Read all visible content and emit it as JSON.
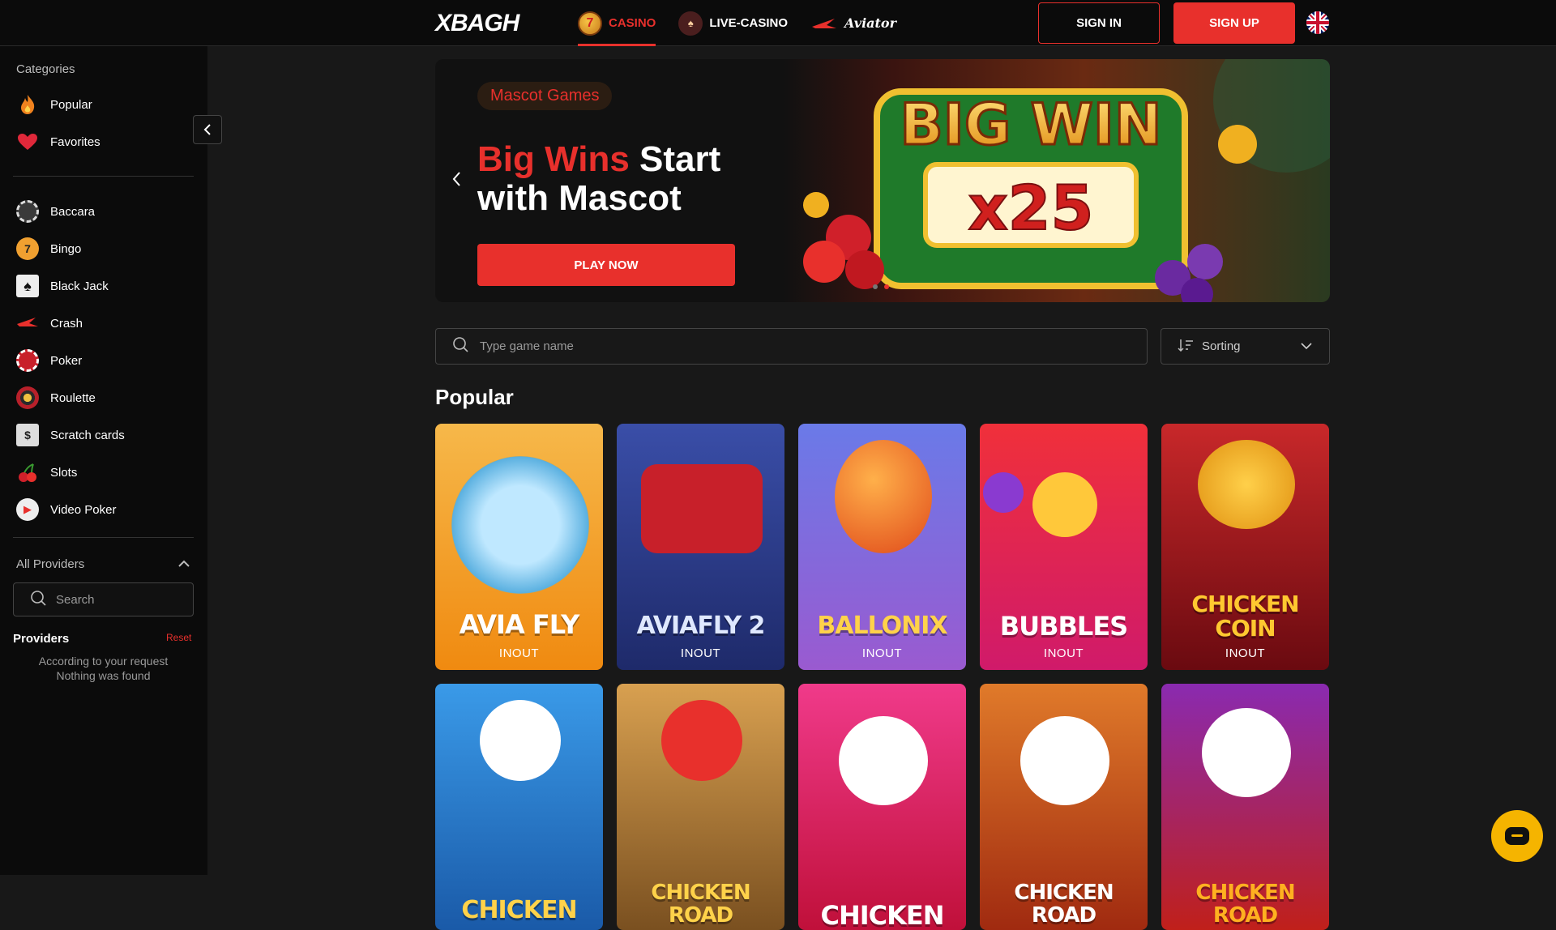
{
  "header": {
    "logo": "XBAGH",
    "nav": [
      {
        "label": "CASINO",
        "icon": "casino-seven-icon",
        "active": true
      },
      {
        "label": "LIVE-CASINO",
        "icon": "live-dealer-icon",
        "active": false
      },
      {
        "label": "Aviator",
        "icon": "aviator-plane-icon",
        "active": false
      }
    ],
    "signin_label": "SIGN IN",
    "signup_label": "SIGN UP",
    "language_icon": "uk-flag-icon",
    "accent_color": "#e8302c"
  },
  "sidebar": {
    "categories_heading": "Categories",
    "top_items": [
      {
        "label": "Popular",
        "icon": "flame-icon"
      },
      {
        "label": "Favorites",
        "icon": "heart-icon"
      }
    ],
    "items": [
      {
        "label": "Baccara",
        "icon": "baccara-chip-icon"
      },
      {
        "label": "Bingo",
        "icon": "bingo-ball-icon"
      },
      {
        "label": "Black Jack",
        "icon": "cards-icon"
      },
      {
        "label": "Crash",
        "icon": "crash-plane-icon"
      },
      {
        "label": "Poker",
        "icon": "poker-chip-icon"
      },
      {
        "label": "Roulette",
        "icon": "roulette-icon"
      },
      {
        "label": "Scratch cards",
        "icon": "scratch-card-icon"
      },
      {
        "label": "Slots",
        "icon": "cherries-icon"
      },
      {
        "label": "Video Poker",
        "icon": "video-poker-icon"
      }
    ],
    "providers_toggle": "All Providers",
    "provider_search_placeholder": "Search",
    "providers_label": "Providers",
    "reset_label": "Reset",
    "empty_line1": "According to your request",
    "empty_line2": "Nothing was found"
  },
  "banner": {
    "tag": "Mascot Games",
    "title_red": "Big Wins",
    "title_rest": " Start",
    "title_line2": "with Mascot",
    "play_label": "PLAY NOW",
    "art_text_top": "BIG WIN",
    "art_text_bottom": "x25",
    "slides": 2,
    "active_slide": 2
  },
  "search": {
    "placeholder": "Type game name",
    "sorting_label": "Sorting"
  },
  "section": {
    "title": "Popular"
  },
  "games": [
    {
      "title": "AVIA FLY",
      "provider": "INOUT",
      "bg": "#f6a12a"
    },
    {
      "title": "AVIAFLY 2",
      "provider": "INOUT",
      "bg": "#2d3f8a"
    },
    {
      "title": "BALLONIX",
      "provider": "INOUT",
      "bg": "#6a5ad0"
    },
    {
      "title": "BUBBLES",
      "provider": "INOUT",
      "bg": "#e0325a"
    },
    {
      "title": "CHICKEN COIN",
      "provider": "INOUT",
      "bg": "#b31a1a"
    },
    {
      "title": "CHICKEN",
      "provider": "",
      "bg": "#2a7dd6"
    },
    {
      "title": "CHICKEN ROAD",
      "provider": "",
      "bg": "#c98a3a"
    },
    {
      "title": "CHICKEN",
      "provider": "",
      "bg": "#e0326e"
    },
    {
      "title": "CHICKEN ROAD",
      "provider": "",
      "bg": "#d2551e"
    },
    {
      "title": "CHICKEN ROAD",
      "provider": "",
      "bg": "#7a1a9a"
    }
  ]
}
